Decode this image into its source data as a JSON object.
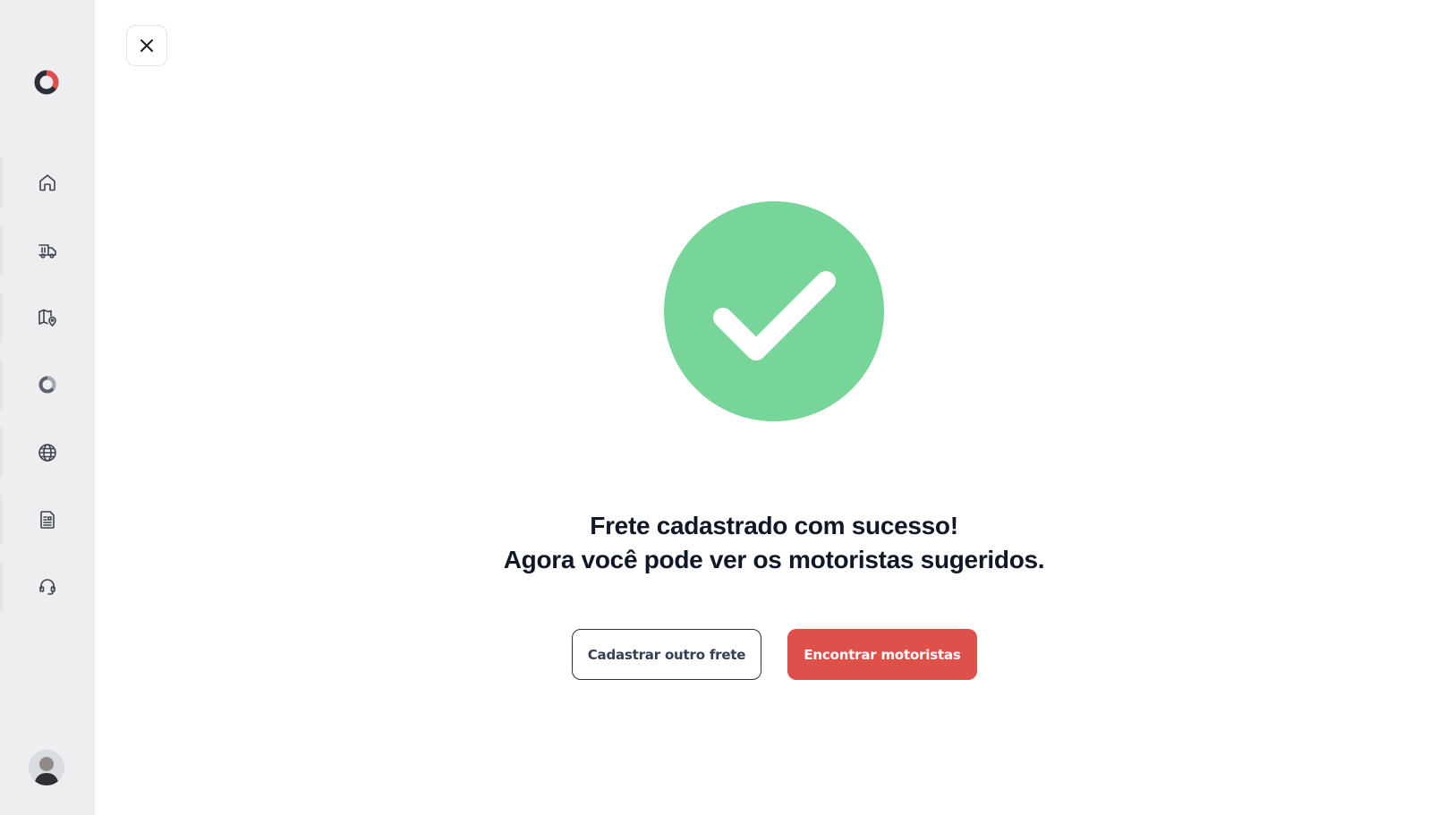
{
  "sidebar": {
    "logo_icon": "brand-logo-icon",
    "items": [
      {
        "name": "home",
        "icon": "home-icon"
      },
      {
        "name": "freight",
        "icon": "truck-icon"
      },
      {
        "name": "map",
        "icon": "map-pin-icon"
      },
      {
        "name": "brand",
        "icon": "brand-ring-icon"
      },
      {
        "name": "globe",
        "icon": "globe-icon"
      },
      {
        "name": "documents",
        "icon": "document-icon"
      },
      {
        "name": "support",
        "icon": "headset-icon"
      }
    ],
    "avatar_icon": "user-avatar"
  },
  "close_icon": "close-icon",
  "success": {
    "icon": "check-circle-icon",
    "color": "#78d59a",
    "line1": "Frete cadastrado com sucesso!",
    "line2": "Agora você pode ver os motoristas sugeridos."
  },
  "actions": {
    "secondary_label": "Cadastrar outro frete",
    "primary_label": "Encontrar motoristas",
    "primary_color": "#e0504b"
  }
}
